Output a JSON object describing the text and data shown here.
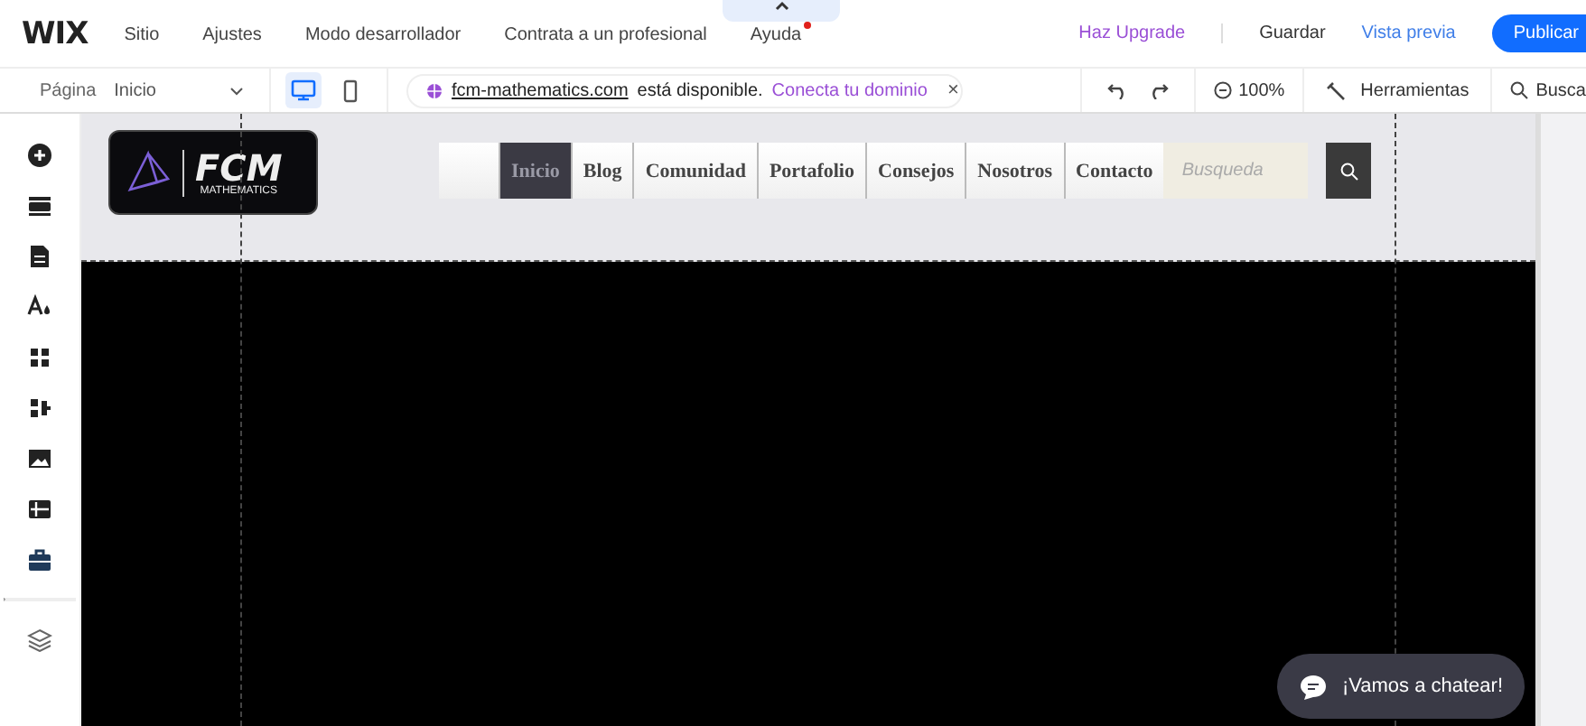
{
  "top_bar": {
    "logo": "WIX",
    "menu": [
      {
        "label": "Sitio",
        "notification": false
      },
      {
        "label": "Ajustes",
        "notification": false
      },
      {
        "label": "Modo desarrollador",
        "notification": false
      },
      {
        "label": "Contrata a un profesional",
        "notification": false
      },
      {
        "label": "Ayuda",
        "notification": true
      }
    ],
    "actions": [
      {
        "label": "Haz Upgrade",
        "kind": "upgrade"
      },
      {
        "label": "Guardar",
        "kind": "plain"
      },
      {
        "label": "Vista previa",
        "kind": "preview"
      },
      {
        "label": "Publicar",
        "kind": "primary"
      }
    ]
  },
  "toolbar": {
    "page_label": "Página",
    "page": "Inicio",
    "devices": [
      {
        "kind": "desktop",
        "selected": true
      },
      {
        "kind": "mobile",
        "selected": false
      }
    ],
    "domain_banner": {
      "domain": "fcm-mathematics.com",
      "message": "está disponible.",
      "link": "Conecta tu dominio",
      "close": "×"
    },
    "zoom": "100%",
    "tools": "Herramientas",
    "search": "Busca"
  },
  "site": {
    "logo": {
      "title": "FCM",
      "subtitle": "MATHEMATICS"
    },
    "nav": [
      {
        "label": "Inicio",
        "selected": true
      },
      {
        "label": "Blog",
        "selected": false
      },
      {
        "label": "Comunidad",
        "selected": false
      },
      {
        "label": "Portafolio",
        "selected": false
      },
      {
        "label": "Consejos",
        "selected": false
      },
      {
        "label": "Nosotros",
        "selected": false
      },
      {
        "label": "Contacto",
        "selected": false
      }
    ],
    "search": {
      "placeholder": "Busqueda"
    },
    "chat": "¡Vamos a chatear!"
  }
}
